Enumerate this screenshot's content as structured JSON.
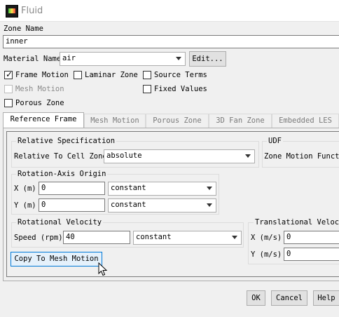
{
  "window": {
    "title": "Fluid"
  },
  "zone": {
    "label": "Zone Name",
    "value": "inner"
  },
  "material": {
    "label": "Material Name",
    "value": "air",
    "edit_label": "Edit..."
  },
  "options": {
    "frame_motion": {
      "label": "Frame Motion",
      "checked": true
    },
    "laminar_zone": {
      "label": "Laminar Zone",
      "checked": false
    },
    "source_terms": {
      "label": "Source Terms",
      "checked": false
    },
    "mesh_motion": {
      "label": "Mesh Motion",
      "checked": false,
      "disabled": true
    },
    "fixed_values": {
      "label": "Fixed Values",
      "checked": false
    },
    "porous_zone": {
      "label": "Porous Zone",
      "checked": false
    }
  },
  "tabs": [
    "Reference Frame",
    "Mesh Motion",
    "Porous Zone",
    "3D Fan Zone",
    "Embedded LES"
  ],
  "relative_spec": {
    "title": "Relative Specification",
    "label": "Relative To Cell Zone",
    "value": "absolute"
  },
  "udf": {
    "title": "UDF",
    "label": "Zone Motion Functi"
  },
  "rotation_axis_origin": {
    "title": "Rotation-Axis Origin",
    "x_label": "X (m)",
    "x_value": "0",
    "x_method": "constant",
    "y_label": "Y (m)",
    "y_value": "0",
    "y_method": "constant"
  },
  "rotational_velocity": {
    "title": "Rotational Velocity",
    "label": "Speed (rpm)",
    "value": "40",
    "method": "constant"
  },
  "translational_velocity": {
    "title": "Translational Velocit",
    "x_label": "X (m/s)",
    "x_value": "0",
    "y_label": "Y (m/s)",
    "y_value": "0"
  },
  "copy_button": "Copy To Mesh Motion",
  "footer": {
    "ok": "OK",
    "cancel": "Cancel",
    "help": "Help"
  },
  "colors": {
    "accent_border": "#0078d7",
    "active_button_bg": "#e5f1fb"
  }
}
